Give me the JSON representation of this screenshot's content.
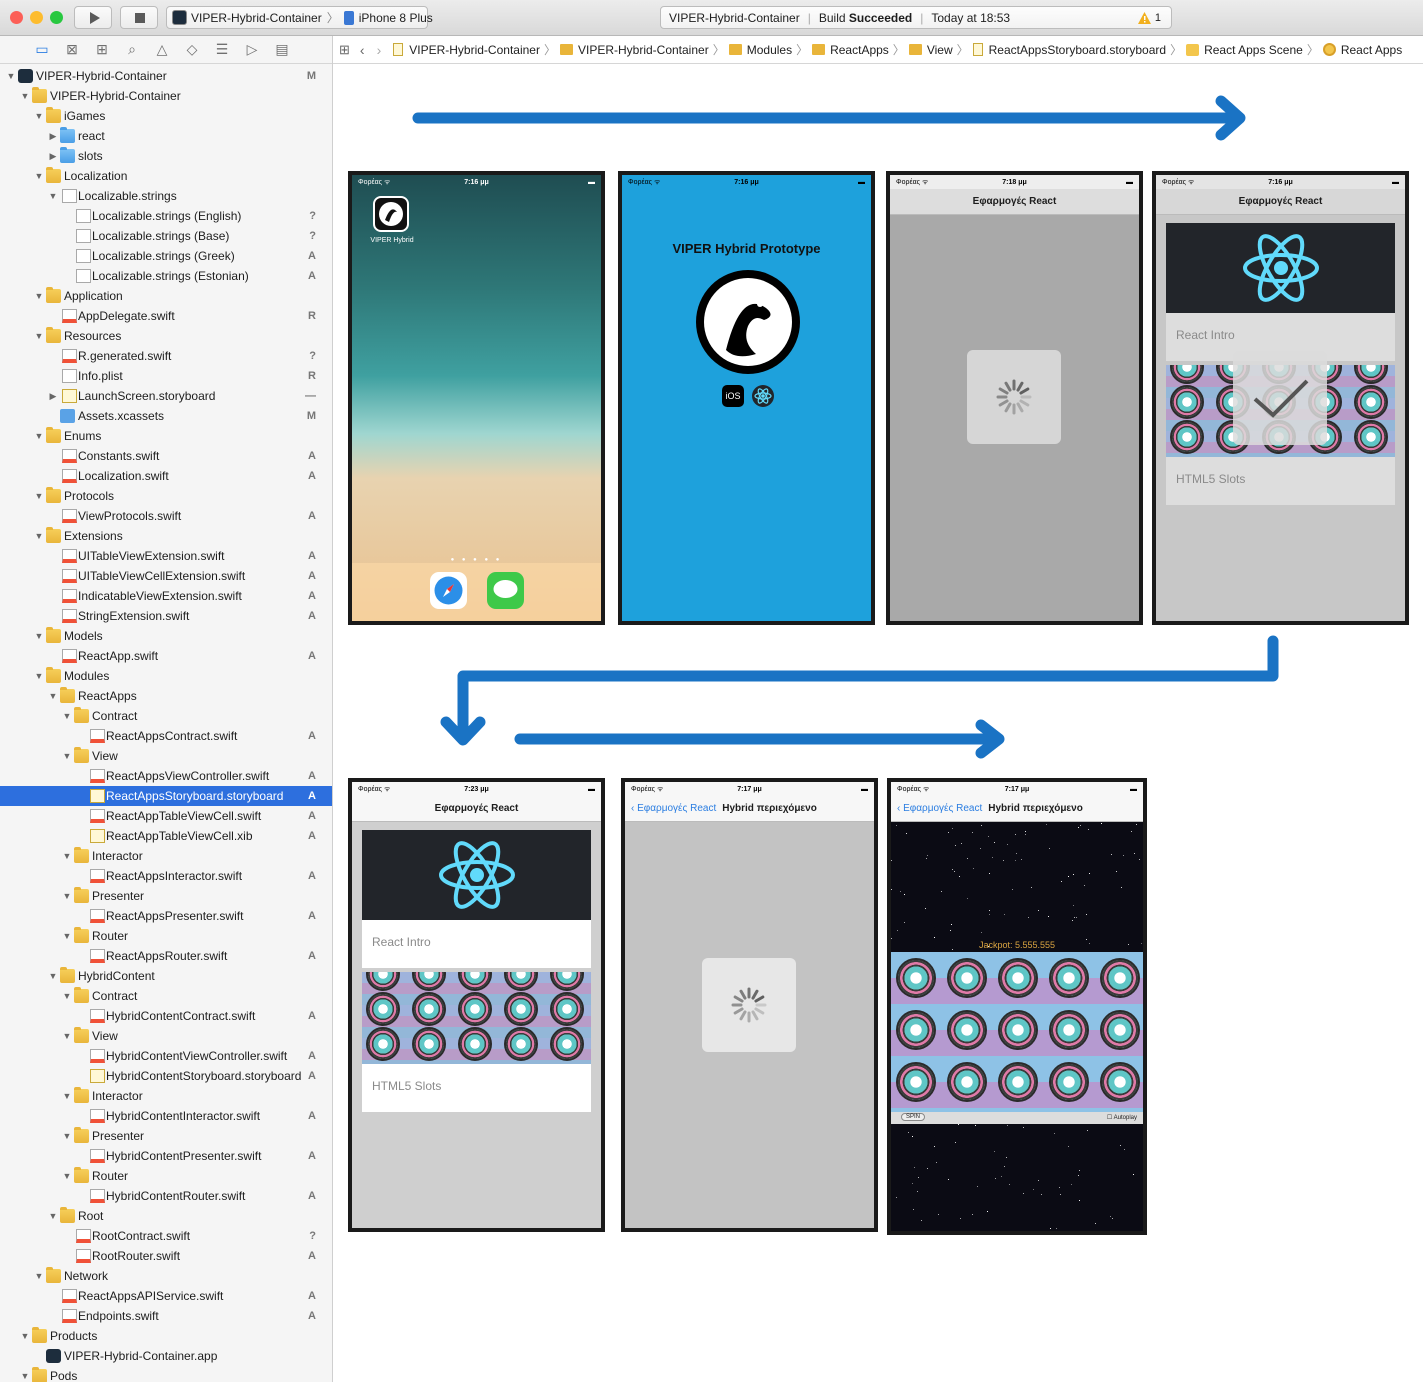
{
  "toolbar": {
    "scheme_project": "VIPER-Hybrid-Container",
    "scheme_device": "iPhone 8 Plus",
    "activity_project": "VIPER-Hybrid-Container",
    "activity_build_prefix": "Build",
    "activity_build_status": "Succeeded",
    "activity_time": "Today at 18:53",
    "warning_count": "1",
    "colors": {
      "close": "#fc5f57",
      "minimize": "#fdbc2e",
      "zoom": "#28c840"
    }
  },
  "navigator": {
    "rows": [
      {
        "label": "VIPER-Hybrid-Container",
        "status": "M",
        "depth": 0,
        "icon": "app",
        "open": true
      },
      {
        "label": "VIPER-Hybrid-Container",
        "status": "",
        "depth": 1,
        "icon": "folder",
        "open": true
      },
      {
        "label": "iGames",
        "status": "",
        "depth": 2,
        "icon": "folder",
        "open": true
      },
      {
        "label": "react",
        "status": "",
        "depth": 3,
        "icon": "bluefolder",
        "open": false
      },
      {
        "label": "slots",
        "status": "",
        "depth": 3,
        "icon": "bluefolder",
        "open": false
      },
      {
        "label": "Localization",
        "status": "",
        "depth": 2,
        "icon": "folder",
        "open": true
      },
      {
        "label": "Localizable.strings",
        "status": "",
        "depth": 3,
        "icon": "file",
        "open": true
      },
      {
        "label": "Localizable.strings (English)",
        "status": "?",
        "depth": 4,
        "icon": "file"
      },
      {
        "label": "Localizable.strings (Base)",
        "status": "?",
        "depth": 4,
        "icon": "file"
      },
      {
        "label": "Localizable.strings (Greek)",
        "status": "A",
        "depth": 4,
        "icon": "file"
      },
      {
        "label": "Localizable.strings (Estonian)",
        "status": "A",
        "depth": 4,
        "icon": "file"
      },
      {
        "label": "Application",
        "status": "",
        "depth": 2,
        "icon": "folder",
        "open": true
      },
      {
        "label": "AppDelegate.swift",
        "status": "R",
        "depth": 3,
        "icon": "swift"
      },
      {
        "label": "Resources",
        "status": "",
        "depth": 2,
        "icon": "folder",
        "open": true
      },
      {
        "label": "R.generated.swift",
        "status": "?",
        "depth": 3,
        "icon": "swift"
      },
      {
        "label": "Info.plist",
        "status": "R",
        "depth": 3,
        "icon": "file"
      },
      {
        "label": "LaunchScreen.storyboard",
        "status": "—",
        "depth": 3,
        "icon": "sb",
        "open": false
      },
      {
        "label": "Assets.xcassets",
        "status": "M",
        "depth": 3,
        "icon": "assets"
      },
      {
        "label": "Enums",
        "status": "",
        "depth": 2,
        "icon": "folder",
        "open": true
      },
      {
        "label": "Constants.swift",
        "status": "A",
        "depth": 3,
        "icon": "swift"
      },
      {
        "label": "Localization.swift",
        "status": "A",
        "depth": 3,
        "icon": "swift"
      },
      {
        "label": "Protocols",
        "status": "",
        "depth": 2,
        "icon": "folder",
        "open": true
      },
      {
        "label": "ViewProtocols.swift",
        "status": "A",
        "depth": 3,
        "icon": "swift"
      },
      {
        "label": "Extensions",
        "status": "",
        "depth": 2,
        "icon": "folder",
        "open": true
      },
      {
        "label": "UITableViewExtension.swift",
        "status": "A",
        "depth": 3,
        "icon": "swift"
      },
      {
        "label": "UITableViewCellExtension.swift",
        "status": "A",
        "depth": 3,
        "icon": "swift"
      },
      {
        "label": "IndicatableViewExtension.swift",
        "status": "A",
        "depth": 3,
        "icon": "swift"
      },
      {
        "label": "StringExtension.swift",
        "status": "A",
        "depth": 3,
        "icon": "swift"
      },
      {
        "label": "Models",
        "status": "",
        "depth": 2,
        "icon": "folder",
        "open": true
      },
      {
        "label": "ReactApp.swift",
        "status": "A",
        "depth": 3,
        "icon": "swift"
      },
      {
        "label": "Modules",
        "status": "",
        "depth": 2,
        "icon": "folder",
        "open": true
      },
      {
        "label": "ReactApps",
        "status": "",
        "depth": 3,
        "icon": "folder",
        "open": true
      },
      {
        "label": "Contract",
        "status": "",
        "depth": 4,
        "icon": "folder",
        "open": true
      },
      {
        "label": "ReactAppsContract.swift",
        "status": "A",
        "depth": 5,
        "icon": "swift"
      },
      {
        "label": "View",
        "status": "",
        "depth": 4,
        "icon": "folder",
        "open": true
      },
      {
        "label": "ReactAppsViewController.swift",
        "status": "A",
        "depth": 5,
        "icon": "swift"
      },
      {
        "label": "ReactAppsStoryboard.storyboard",
        "status": "A",
        "depth": 5,
        "icon": "sb",
        "selected": true
      },
      {
        "label": "ReactAppTableViewCell.swift",
        "status": "A",
        "depth": 5,
        "icon": "swift"
      },
      {
        "label": "ReactAppTableViewCell.xib",
        "status": "A",
        "depth": 5,
        "icon": "sb"
      },
      {
        "label": "Interactor",
        "status": "",
        "depth": 4,
        "icon": "folder",
        "open": true
      },
      {
        "label": "ReactAppsInteractor.swift",
        "status": "A",
        "depth": 5,
        "icon": "swift"
      },
      {
        "label": "Presenter",
        "status": "",
        "depth": 4,
        "icon": "folder",
        "open": true
      },
      {
        "label": "ReactAppsPresenter.swift",
        "status": "A",
        "depth": 5,
        "icon": "swift"
      },
      {
        "label": "Router",
        "status": "",
        "depth": 4,
        "icon": "folder",
        "open": true
      },
      {
        "label": "ReactAppsRouter.swift",
        "status": "A",
        "depth": 5,
        "icon": "swift"
      },
      {
        "label": "HybridContent",
        "status": "",
        "depth": 3,
        "icon": "folder",
        "open": true
      },
      {
        "label": "Contract",
        "status": "",
        "depth": 4,
        "icon": "folder",
        "open": true
      },
      {
        "label": "HybridContentContract.swift",
        "status": "A",
        "depth": 5,
        "icon": "swift"
      },
      {
        "label": "View",
        "status": "",
        "depth": 4,
        "icon": "folder",
        "open": true
      },
      {
        "label": "HybridContentViewController.swift",
        "status": "A",
        "depth": 5,
        "icon": "swift"
      },
      {
        "label": "HybridContentStoryboard.storyboard",
        "status": "A",
        "depth": 5,
        "icon": "sb"
      },
      {
        "label": "Interactor",
        "status": "",
        "depth": 4,
        "icon": "folder",
        "open": true
      },
      {
        "label": "HybridContentInteractor.swift",
        "status": "A",
        "depth": 5,
        "icon": "swift"
      },
      {
        "label": "Presenter",
        "status": "",
        "depth": 4,
        "icon": "folder",
        "open": true
      },
      {
        "label": "HybridContentPresenter.swift",
        "status": "A",
        "depth": 5,
        "icon": "swift"
      },
      {
        "label": "Router",
        "status": "",
        "depth": 4,
        "icon": "folder",
        "open": true
      },
      {
        "label": "HybridContentRouter.swift",
        "status": "A",
        "depth": 5,
        "icon": "swift"
      },
      {
        "label": "Root",
        "status": "",
        "depth": 3,
        "icon": "folder",
        "open": true
      },
      {
        "label": "RootContract.swift",
        "status": "?",
        "depth": 4,
        "icon": "swift"
      },
      {
        "label": "RootRouter.swift",
        "status": "A",
        "depth": 4,
        "icon": "swift"
      },
      {
        "label": "Network",
        "status": "",
        "depth": 2,
        "icon": "folder",
        "open": true
      },
      {
        "label": "ReactAppsAPIService.swift",
        "status": "A",
        "depth": 3,
        "icon": "swift"
      },
      {
        "label": "Endpoints.swift",
        "status": "A",
        "depth": 3,
        "icon": "swift"
      },
      {
        "label": "Products",
        "status": "",
        "depth": 1,
        "icon": "folder",
        "open": true
      },
      {
        "label": "VIPER-Hybrid-Container.app",
        "status": "",
        "depth": 2,
        "icon": "app"
      },
      {
        "label": "Pods",
        "status": "",
        "depth": 1,
        "icon": "folder",
        "open": true
      }
    ]
  },
  "jumpbar": {
    "items": [
      {
        "label": "VIPER-Hybrid-Container",
        "icon": "file"
      },
      {
        "label": "VIPER-Hybrid-Container",
        "icon": "folder"
      },
      {
        "label": "Modules",
        "icon": "folder"
      },
      {
        "label": "ReactApps",
        "icon": "folder"
      },
      {
        "label": "View",
        "icon": "folder"
      },
      {
        "label": "ReactAppsStoryboard.storyboard",
        "icon": "storyboard"
      },
      {
        "label": "React Apps Scene",
        "icon": "scene"
      },
      {
        "label": "React Apps",
        "icon": "view-controller"
      }
    ]
  },
  "screens": {
    "home": {
      "carrier": "Φορέας ᯤ",
      "time": "7:16 μμ",
      "app_label": "VIPER Hybrid"
    },
    "splash": {
      "carrier": "Φορέας ᯤ",
      "time": "7:16 μμ",
      "title": "VIPER Hybrid Prototype",
      "ios_badge": "iOS",
      "bg": "#1ea1dc"
    },
    "loading1": {
      "carrier": "Φορέας ᯤ",
      "time": "7:18 μμ",
      "title": "Εφαρμογές React"
    },
    "list_selected": {
      "carrier": "Φορέας ᯤ",
      "time": "7:16 μμ",
      "title": "Εφαρμογές React",
      "cell1": "React Intro",
      "cell2": "HTML5 Slots"
    },
    "list": {
      "carrier": "Φορέας ᯤ",
      "time": "7:23 μμ",
      "title": "Εφαρμογές React",
      "cell1": "React Intro",
      "cell2": "HTML5 Slots"
    },
    "hybrid_loading": {
      "carrier": "Φορέας ᯤ",
      "time": "7:17 μμ",
      "back": "Εφαρμογές React",
      "title": "Hybrid περιεχόμενο"
    },
    "hybrid_slots": {
      "carrier": "Φορέας ᯤ",
      "time": "7:17 μμ",
      "back": "Εφαρμογές React",
      "title": "Hybrid περιεχόμενο",
      "jackpot": "Jackpot: 5.555.555",
      "spin": "SPIN",
      "autoplay": "Autoplay"
    }
  },
  "colors": {
    "arrow": "#1a73c4",
    "selection": "#2d6fde",
    "react": "#61dafb"
  }
}
